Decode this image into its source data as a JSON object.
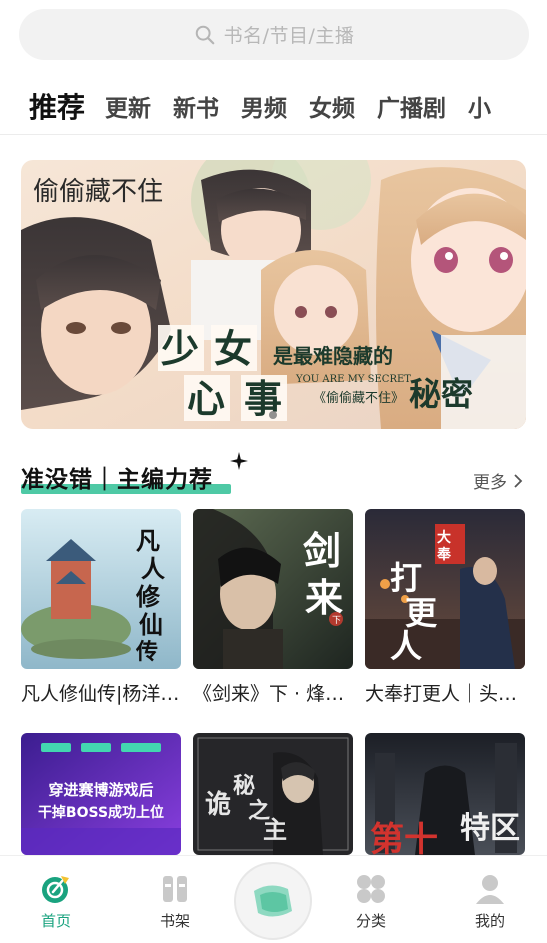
{
  "search": {
    "placeholder": "书名/节目/主播"
  },
  "tabs": [
    "推荐",
    "更新",
    "新书",
    "男频",
    "女频",
    "广播剧",
    "小"
  ],
  "banner": {
    "title_calligraphy": "偷偷藏不住",
    "line1": "少女",
    "line2": "是最难隐藏的",
    "line3": "心事",
    "line4": "秘密",
    "english": "YOU ARE MY SECRET",
    "subtitle": "《偷偷藏不住》"
  },
  "section": {
    "title": "准没错｜主编力荐",
    "more": "更多"
  },
  "cards_row1": [
    {
      "title": "凡人修仙传|杨洋…",
      "cover_text": "凡人修仙传",
      "accent": "#8fb7c9"
    },
    {
      "title": "《剑来》下 · 烽…",
      "cover_text": "剑来",
      "accent": "#3d4a3b"
    },
    {
      "title": "大奉打更人｜头…",
      "cover_text": "打更人",
      "badge": "大奉",
      "accent": "#4a3a36"
    }
  ],
  "cards_row2": [
    {
      "title": "穿进赛博游戏后干掉BOSS成功上位",
      "line1": "穿进赛博游戏后",
      "line2": "干掉BOSS成功上位",
      "accent": "#6a2fd0"
    },
    {
      "title": "诡秘之主",
      "cover_text": "诡秘之主",
      "accent": "#2a2a2e"
    },
    {
      "title": "特区",
      "cover_text": "第十特区",
      "accent": "#3b3f46"
    }
  ],
  "nav": {
    "home": "首页",
    "shelf": "书架",
    "category": "分类",
    "mine": "我的"
  },
  "colors": {
    "accent_green": "#1aa37f",
    "section_bar": "#2fbf95"
  }
}
